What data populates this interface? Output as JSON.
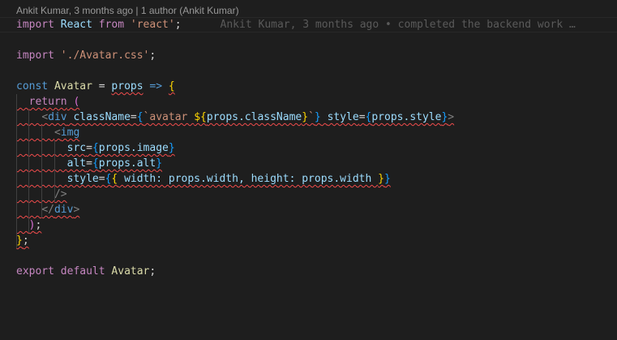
{
  "codelens": {
    "text": "Ankit Kumar, 3 months ago | 1 author (Ankit Kumar)"
  },
  "blame": {
    "text": "Ankit Kumar, 3 months ago • completed the backend work …"
  },
  "code": {
    "l1": {
      "kw1": "import",
      "name": "React",
      "kw2": "from",
      "str": "'react'",
      "semi": ";"
    },
    "l3": {
      "kw": "import",
      "str": "'./Avatar.css'",
      "semi": ";"
    },
    "l5": {
      "kw": "const",
      "name": "Avatar",
      "eq": "=",
      "param": "props",
      "arrow": "=>",
      "brace": "{"
    },
    "l6": {
      "kw": "return",
      "paren": "("
    },
    "l7": {
      "lt": "<",
      "tag": "div",
      "attr1": "className",
      "eq1": "=",
      "ob1": "{",
      "tpl_start": "`avatar ",
      "interp_open": "${",
      "expr": "props.className",
      "interp_close": "}",
      "tpl_end": "`",
      "cb1": "}",
      "attr2": "style",
      "eq2": "=",
      "ob2": "{",
      "expr2": "props.style",
      "cb2": "}",
      "gt": ">"
    },
    "l8": {
      "lt": "<",
      "tag": "img"
    },
    "l9": {
      "attr": "src",
      "eq": "=",
      "ob": "{",
      "expr": "props.image",
      "cb": "}"
    },
    "l10": {
      "attr": "alt",
      "eq": "=",
      "ob": "{",
      "expr": "props.alt",
      "cb": "}"
    },
    "l11": {
      "attr": "style",
      "eq": "=",
      "ob": "{",
      "ob2": "{",
      "content": " width: props.width, height: props.width ",
      "cb2": "}",
      "cb": "}"
    },
    "l12": {
      "text": "/>"
    },
    "l13": {
      "lt": "</",
      "tag": "div",
      "gt": ">"
    },
    "l14": {
      "paren": ")",
      "semi": ";"
    },
    "l15": {
      "brace": "}",
      "semi": ";"
    },
    "l17": {
      "kw1": "export",
      "kw2": "default",
      "name": "Avatar",
      "semi": ";"
    }
  }
}
